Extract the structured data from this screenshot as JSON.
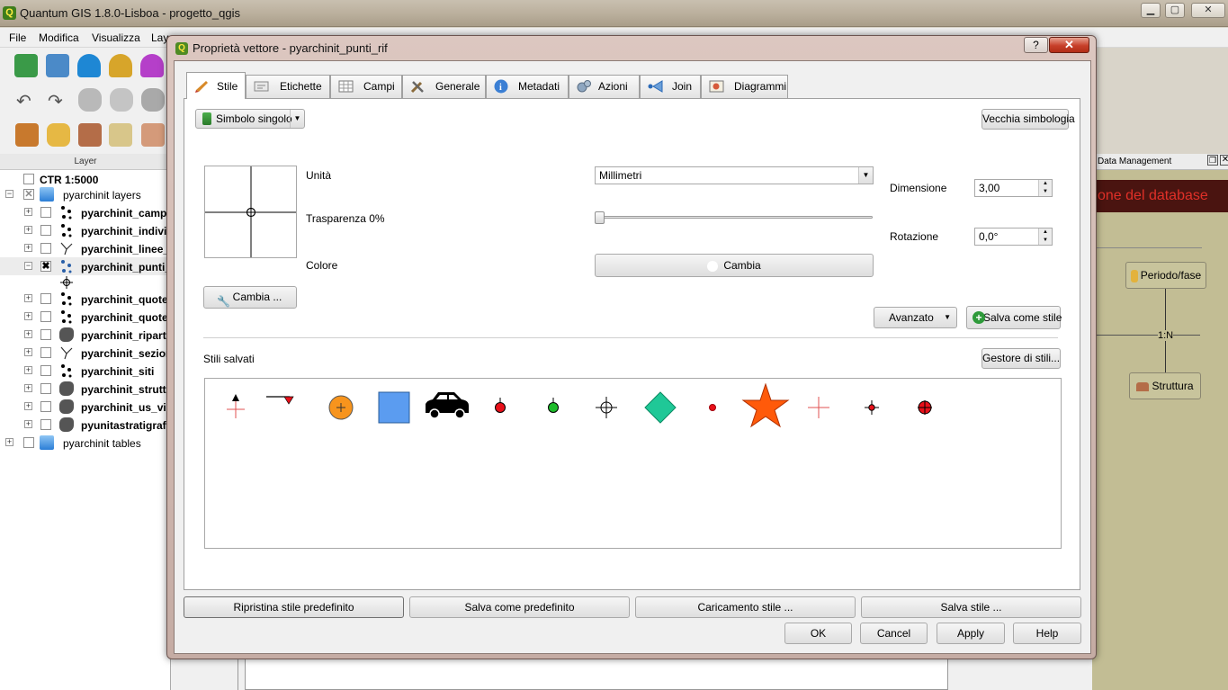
{
  "main_window": {
    "title": "Quantum GIS 1.8.0-Lisboa - progetto_qgis",
    "controls": {
      "minimize": "▁",
      "maximize": "▢",
      "close": "✕"
    }
  },
  "menubar": [
    "File",
    "Modifica",
    "Visualizza",
    "Layer"
  ],
  "layer_panel": {
    "title": "Layer",
    "items": [
      {
        "label": "CTR 1:5000",
        "checked": false,
        "bold": true
      },
      {
        "label": "pyarchinit layers",
        "checked": true,
        "bold": false
      },
      {
        "label": "pyarchinit_campionature",
        "checked": false,
        "bold": true
      },
      {
        "label": "pyarchinit_individui",
        "checked": false,
        "bold": true
      },
      {
        "label": "pyarchinit_linee_rif",
        "checked": false,
        "bold": true
      },
      {
        "label": "pyarchinit_punti_rif",
        "checked": true,
        "bold": true
      },
      {
        "label": "pyarchinit_quote",
        "checked": false,
        "bold": true
      },
      {
        "label": "pyarchinit_quote_usm",
        "checked": false,
        "bold": true
      },
      {
        "label": "pyarchinit_ripartizioni",
        "checked": false,
        "bold": true
      },
      {
        "label": "pyarchinit_sezioni",
        "checked": false,
        "bold": true
      },
      {
        "label": "pyarchinit_siti",
        "checked": false,
        "bold": true
      },
      {
        "label": "pyarchinit_strutture",
        "checked": false,
        "bold": true
      },
      {
        "label": "pyarchinit_us_view",
        "checked": false,
        "bold": true
      },
      {
        "label": "pyunitastratigrafiche",
        "checked": false,
        "bold": true
      },
      {
        "label": "pyarchinit tables",
        "checked": false,
        "bold": false
      }
    ]
  },
  "right_panel": {
    "title": "Data Management",
    "banner": "one del database",
    "nodes": {
      "periodo": "Periodo/fase",
      "relation": "1:N",
      "struttura": "Struttura"
    }
  },
  "dialog": {
    "title": "Proprietà vettore - pyarchinit_punti_rif",
    "help_button": "?",
    "close_button": "✕",
    "tabs": [
      "Stile",
      "Etichette",
      "Campi",
      "Generale",
      "Metadati",
      "Azioni",
      "Join",
      "Diagrammi"
    ],
    "active_tab": "Stile",
    "style": {
      "renderer": "Simbolo singolo",
      "old_symbology_button": "Vecchia simbologia",
      "unit_label": "Unità",
      "unit_value": "Millimetri",
      "transparency_label": "Trasparenza 0%",
      "transparency_value": 0,
      "color_label": "Colore",
      "color_button": "Cambia",
      "size_label": "Dimensione",
      "size_value": "3,00",
      "rotation_label": "Rotazione",
      "rotation_value": "0,0°",
      "change_symbol_button": "Cambia ...",
      "advanced_button": "Avanzato",
      "save_as_style_button": "Salva come stile",
      "saved_styles_label": "Stili salvati",
      "style_manager_button": "Gestore di stili..."
    },
    "footer_buttons": [
      "Ripristina stile predefinito",
      "Salva come predefinito",
      "Caricamento stile ...",
      "Salva stile ..."
    ],
    "dialog_buttons": [
      "OK",
      "Cancel",
      "Apply",
      "Help"
    ]
  },
  "colors": {
    "symbol_orange": "#f7941d",
    "symbol_blue": "#5b9cf0",
    "symbol_teal": "#1fc897",
    "symbol_star": "#ff5a0a",
    "symbol_red": "#e8101a",
    "symbol_green": "#1dbb2a"
  }
}
